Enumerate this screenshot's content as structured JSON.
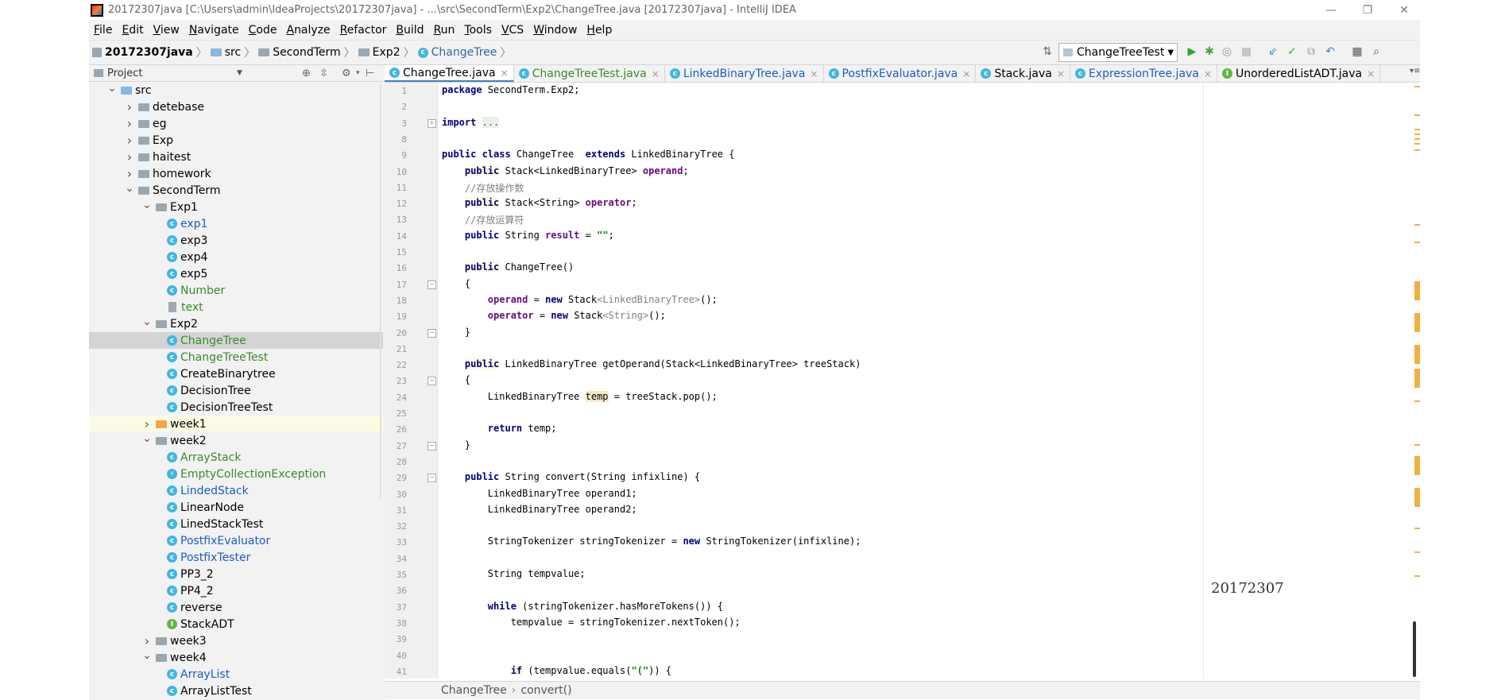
{
  "window": {
    "title": "20172307java [C:\\Users\\admin\\IdeaProjects\\20172307java] - ...\\src\\SecondTerm\\Exp2\\ChangeTree.java [20172307java] - IntelliJ IDEA",
    "minimize": "—",
    "restore": "❐",
    "close": "✕"
  },
  "menu": [
    "File",
    "Edit",
    "View",
    "Navigate",
    "Code",
    "Analyze",
    "Refactor",
    "Build",
    "Run",
    "Tools",
    "VCS",
    "Window",
    "Help"
  ],
  "breadcrumb": [
    "20172307java",
    "src",
    "SecondTerm",
    "Exp2",
    "ChangeTree"
  ],
  "run_config": "ChangeTreeTest",
  "project_panel": {
    "title": "Project",
    "tree": [
      {
        "label": "src",
        "indent": 0,
        "arrow": "down",
        "icon": "folder-blue",
        "color": "normal"
      },
      {
        "label": "detebase",
        "indent": 1,
        "arrow": "right",
        "icon": "folder",
        "color": "normal"
      },
      {
        "label": "eg",
        "indent": 1,
        "arrow": "right",
        "icon": "folder",
        "color": "normal"
      },
      {
        "label": "Exp",
        "indent": 1,
        "arrow": "right",
        "icon": "folder",
        "color": "normal"
      },
      {
        "label": "haitest",
        "indent": 1,
        "arrow": "right",
        "icon": "folder",
        "color": "normal"
      },
      {
        "label": "homework",
        "indent": 1,
        "arrow": "right",
        "icon": "folder",
        "color": "normal"
      },
      {
        "label": "SecondTerm",
        "indent": 1,
        "arrow": "down",
        "icon": "folder",
        "color": "normal"
      },
      {
        "label": "Exp1",
        "indent": 2,
        "arrow": "down",
        "icon": "folder",
        "color": "normal"
      },
      {
        "label": "exp1",
        "indent": 3,
        "arrow": "",
        "icon": "class",
        "color": "blue"
      },
      {
        "label": "exp3",
        "indent": 3,
        "arrow": "",
        "icon": "class",
        "color": "normal"
      },
      {
        "label": "exp4",
        "indent": 3,
        "arrow": "",
        "icon": "class",
        "color": "normal"
      },
      {
        "label": "exp5",
        "indent": 3,
        "arrow": "",
        "icon": "class",
        "color": "normal"
      },
      {
        "label": "Number",
        "indent": 3,
        "arrow": "",
        "icon": "class",
        "color": "green"
      },
      {
        "label": "text",
        "indent": 3,
        "arrow": "",
        "icon": "file",
        "color": "green"
      },
      {
        "label": "Exp2",
        "indent": 2,
        "arrow": "down",
        "icon": "folder",
        "color": "normal"
      },
      {
        "label": "ChangeTree",
        "indent": 3,
        "arrow": "",
        "icon": "class",
        "color": "green",
        "selected": true
      },
      {
        "label": "ChangeTreeTest",
        "indent": 3,
        "arrow": "",
        "icon": "class",
        "color": "green"
      },
      {
        "label": "CreateBinarytree",
        "indent": 3,
        "arrow": "",
        "icon": "class",
        "color": "normal"
      },
      {
        "label": "DecisionTree",
        "indent": 3,
        "arrow": "",
        "icon": "class",
        "color": "normal"
      },
      {
        "label": "DecisionTreeTest",
        "indent": 3,
        "arrow": "",
        "icon": "class",
        "color": "normal"
      },
      {
        "label": "week1",
        "indent": 2,
        "arrow": "right",
        "icon": "folder-orange",
        "color": "normal",
        "highlight": true
      },
      {
        "label": "week2",
        "indent": 2,
        "arrow": "down",
        "icon": "folder",
        "color": "normal"
      },
      {
        "label": "ArrayStack",
        "indent": 3,
        "arrow": "",
        "icon": "class",
        "color": "green"
      },
      {
        "label": "EmptyCollectionException",
        "indent": 3,
        "arrow": "",
        "icon": "exception",
        "color": "green"
      },
      {
        "label": "LindedStack",
        "indent": 3,
        "arrow": "",
        "icon": "class",
        "color": "blue"
      },
      {
        "label": "LinearNode",
        "indent": 3,
        "arrow": "",
        "icon": "class",
        "color": "normal"
      },
      {
        "label": "LinedStackTest",
        "indent": 3,
        "arrow": "",
        "icon": "class",
        "color": "normal"
      },
      {
        "label": "PostfixEvaluator",
        "indent": 3,
        "arrow": "",
        "icon": "class",
        "color": "blue"
      },
      {
        "label": "PostfixTester",
        "indent": 3,
        "arrow": "",
        "icon": "class",
        "color": "blue"
      },
      {
        "label": "PP3_2",
        "indent": 3,
        "arrow": "",
        "icon": "class",
        "color": "normal"
      },
      {
        "label": "PP4_2",
        "indent": 3,
        "arrow": "",
        "icon": "class",
        "color": "normal"
      },
      {
        "label": "reverse",
        "indent": 3,
        "arrow": "",
        "icon": "class",
        "color": "normal"
      },
      {
        "label": "StackADT",
        "indent": 3,
        "arrow": "",
        "icon": "interface",
        "color": "normal"
      },
      {
        "label": "week3",
        "indent": 2,
        "arrow": "right",
        "icon": "folder",
        "color": "normal"
      },
      {
        "label": "week4",
        "indent": 2,
        "arrow": "down",
        "icon": "folder",
        "color": "normal"
      },
      {
        "label": "ArrayList",
        "indent": 3,
        "arrow": "",
        "icon": "class",
        "color": "blue"
      },
      {
        "label": "ArrayListTest",
        "indent": 3,
        "arrow": "",
        "icon": "class",
        "color": "normal"
      }
    ]
  },
  "tabs": [
    {
      "label": "ChangeTree.java",
      "icon": "class",
      "active": true,
      "color": "normal"
    },
    {
      "label": "ChangeTreeTest.java",
      "icon": "class",
      "active": false,
      "color": "green"
    },
    {
      "label": "LinkedBinaryTree.java",
      "icon": "class",
      "active": false,
      "color": "blue"
    },
    {
      "label": "PostfixEvaluator.java",
      "icon": "class",
      "active": false,
      "color": "blue"
    },
    {
      "label": "Stack.java",
      "icon": "class",
      "active": false,
      "color": "normal"
    },
    {
      "label": "ExpressionTree.java",
      "icon": "class",
      "active": false,
      "color": "blue"
    },
    {
      "label": "UnorderedListADT.java",
      "icon": "interface",
      "active": false,
      "color": "normal"
    }
  ],
  "tab_close": "×",
  "code_lines": [
    {
      "n": "1",
      "html": "<span class='kw'>package</span> SecondTerm.Exp2;"
    },
    {
      "n": "2",
      "html": ""
    },
    {
      "n": "3",
      "html": "<span class='kw'>import</span> <span class='folded'>...</span>"
    },
    {
      "n": "8",
      "html": ""
    },
    {
      "n": "9",
      "html": "<span class='kw'>public class</span> ChangeTree  <span class='kw'>extends</span> LinkedBinaryTree {"
    },
    {
      "n": "10",
      "html": "    <span class='kw kwh'>public</span> Stack&lt;LinkedBinaryTree&gt; <span class='fld'>operand</span>;"
    },
    {
      "n": "11",
      "html": "    <span class='cmt'>//存放操作数</span>"
    },
    {
      "n": "12",
      "html": "    <span class='kw kwh'>public</span> Stack&lt;String&gt; <span class='fld'>operator</span>;"
    },
    {
      "n": "13",
      "html": "    <span class='cmt'>//存放运算符</span>"
    },
    {
      "n": "14",
      "html": "    <span class='kw'>public</span> String <span class='fld'>result</span> = <span class='str'>\"\"</span>;"
    },
    {
      "n": "15",
      "html": ""
    },
    {
      "n": "16",
      "html": "    <span class='kw kwh'>public</span> ChangeTree()"
    },
    {
      "n": "17",
      "html": "    {"
    },
    {
      "n": "18",
      "html": "        <span class='fld'>operand</span> = <span class='kw'>new</span> Stack<span class='gen'>&lt;LinkedBinaryTree&gt;</span>();"
    },
    {
      "n": "19",
      "html": "        <span class='fld'>operator</span> = <span class='kw'>new</span> Stack<span class='gen'>&lt;String&gt;</span>();"
    },
    {
      "n": "20",
      "html": "    }"
    },
    {
      "n": "21",
      "html": ""
    },
    {
      "n": "22",
      "html": "    <span class='kw kwh'>public</span> LinkedBinaryTree getOperand(Stack&lt;LinkedBinaryTree&gt; treeStack)"
    },
    {
      "n": "23",
      "html": "    {"
    },
    {
      "n": "24",
      "html": "        LinkedBinaryTree <span class='tmpl'>temp</span> = treeStack.pop();"
    },
    {
      "n": "25",
      "html": ""
    },
    {
      "n": "26",
      "html": "        <span class='kw'>return</span> temp;"
    },
    {
      "n": "27",
      "html": "    }"
    },
    {
      "n": "28",
      "html": ""
    },
    {
      "n": "29",
      "html": "    <span class='kw'>public</span> String convert(String infixline) {"
    },
    {
      "n": "30",
      "html": "        LinkedBinaryTree operand1;"
    },
    {
      "n": "31",
      "html": "        LinkedBinaryTree operand2;"
    },
    {
      "n": "32",
      "html": ""
    },
    {
      "n": "33",
      "html": "        StringTokenizer stringTokenizer = <span class='kw'>new</span> StringTokenizer(infixline);"
    },
    {
      "n": "34",
      "html": ""
    },
    {
      "n": "35",
      "html": "        String tempvalue;"
    },
    {
      "n": "36",
      "html": ""
    },
    {
      "n": "37",
      "html": "        <span class='kw'>while</span> (stringTokenizer.hasMoreTokens()) {"
    },
    {
      "n": "38",
      "html": "            tempvalue = stringTokenizer.nextToken();"
    },
    {
      "n": "39",
      "html": ""
    },
    {
      "n": "40",
      "html": ""
    },
    {
      "n": "41",
      "html": "            <span class='kw kwh'>if</span> (tempvalue.equals(<span class='str'>\"(\"</span>)) {"
    }
  ],
  "watermark": "20172307",
  "status_crumb": [
    "ChangeTree",
    "convert()"
  ],
  "colors": {
    "accent": "#4083c9",
    "selection": "#d4d4d4",
    "keyword": "#000080",
    "field": "#660e7a",
    "comment": "#808080"
  },
  "icons": {
    "run": "run-icon",
    "debug": "debug-icon",
    "stop": "stop-icon",
    "search": "search-icon"
  }
}
